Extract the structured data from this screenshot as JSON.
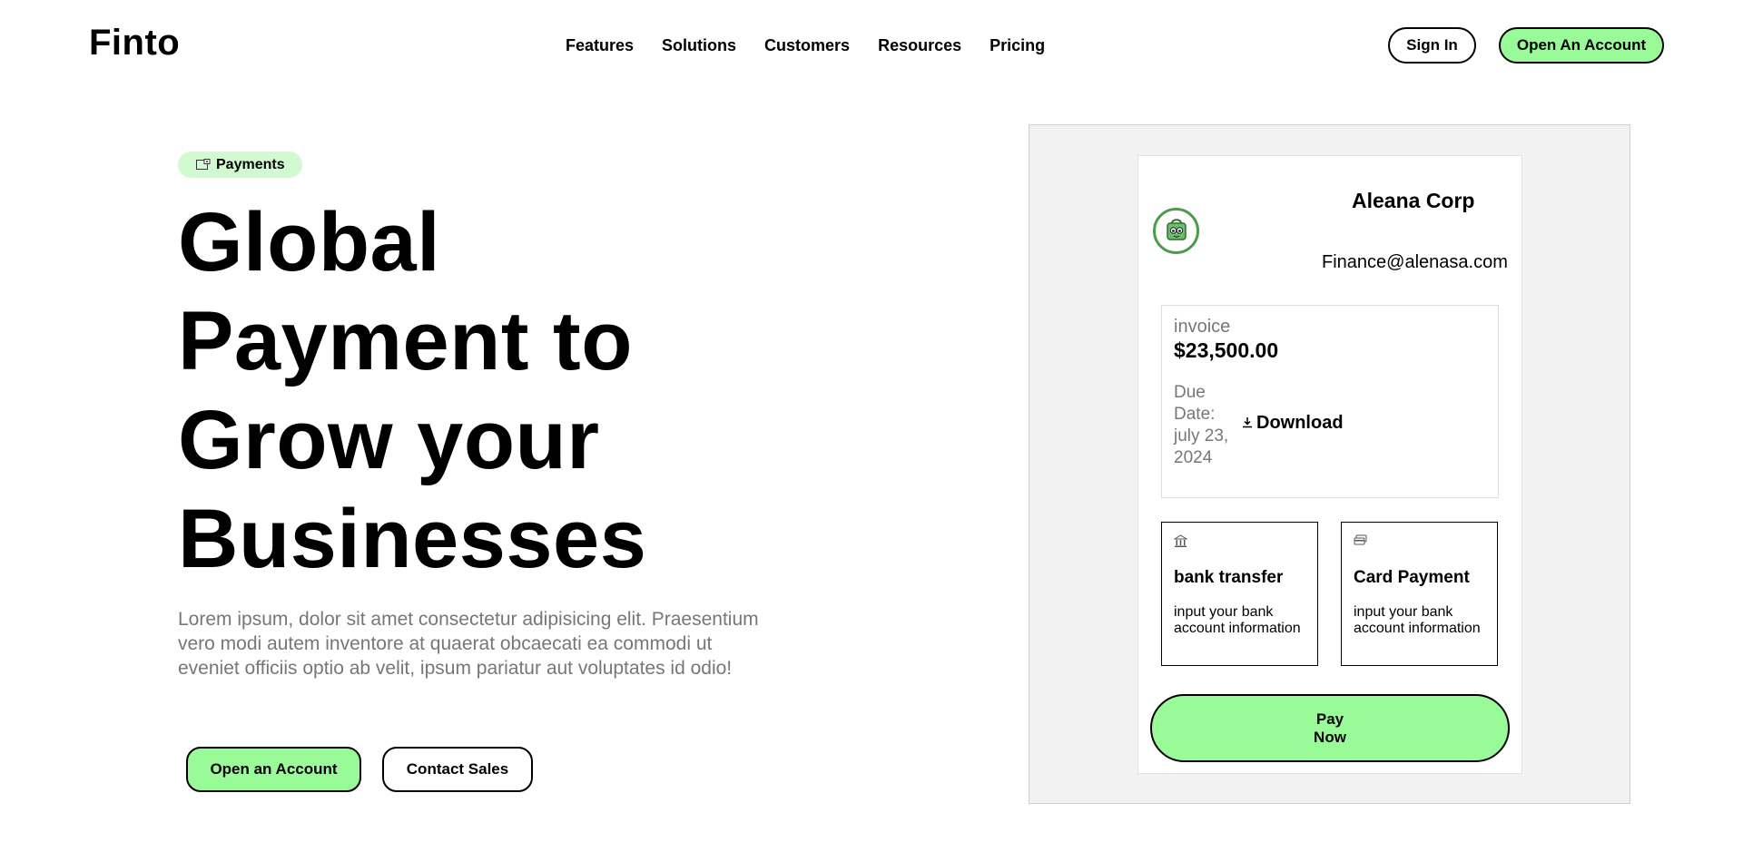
{
  "brand": {
    "logo": "Finto",
    "accent_color": "#98fb98"
  },
  "nav": {
    "items": [
      "Features",
      "Solutions",
      "Customers",
      "Resources",
      "Pricing"
    ]
  },
  "header_actions": {
    "sign_in": "Sign In",
    "open_account": "Open An Account"
  },
  "hero": {
    "badge": {
      "icon": "payments-icon",
      "label": "Payments"
    },
    "title_lines": [
      "Global",
      "Payment to",
      "Grow your",
      "Businesses"
    ],
    "description": "Lorem ipsum, dolor sit amet consectetur adipisicing elit. Praesentium vero modi autem inventore at quaerat obcaecati ea commodi ut eveniet officiis optio ab velit, ipsum pariatur aut voluptates id odio!",
    "primary_button": "Open an Account",
    "secondary_button": "Contact Sales"
  },
  "invoice_preview": {
    "company_name": "Aleana Corp",
    "company_email": "Finance@alenasa.com",
    "invoice_label": "invoice",
    "amount": "$23,500.00",
    "due_date": "Due Date: july 23, 2024",
    "download_label": "Download",
    "payment_methods": [
      {
        "icon": "bank-icon",
        "title": "bank transfer",
        "description": "input your bank account information"
      },
      {
        "icon": "credit-card-icon",
        "title": "Card Payment",
        "description": "input your bank account information"
      }
    ],
    "pay_button": "Pay Now"
  }
}
